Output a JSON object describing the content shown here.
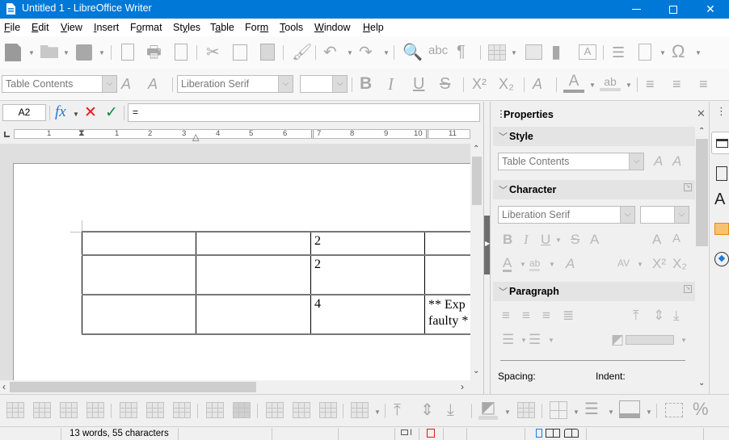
{
  "window": {
    "title": "Untitled 1 - LibreOffice Writer",
    "minimize": "—",
    "maximize": "☐",
    "close": "✕"
  },
  "menu": [
    {
      "label": "File",
      "u": "F",
      "rest": "ile"
    },
    {
      "label": "Edit",
      "u": "E",
      "rest": "dit"
    },
    {
      "label": "View",
      "u": "V",
      "rest": "iew"
    },
    {
      "label": "Insert",
      "u": "I",
      "rest": "nsert"
    },
    {
      "label": "Format",
      "pre": "F",
      "u": "o",
      "rest": "rmat"
    },
    {
      "label": "Styles",
      "pre": "St",
      "u": "y",
      "rest": "les"
    },
    {
      "label": "Table",
      "pre": "T",
      "u": "a",
      "rest": "ble"
    },
    {
      "label": "Form",
      "pre": "For",
      "u": "m",
      "rest": ""
    },
    {
      "label": "Tools",
      "u": "T",
      "rest": "ools"
    },
    {
      "label": "Window",
      "u": "W",
      "rest": "indow"
    },
    {
      "label": "Help",
      "u": "H",
      "rest": "elp"
    }
  ],
  "formatting": {
    "paragraph_style": "Table Contents",
    "font_name": "Liberation Serif",
    "font_size": ""
  },
  "formula_bar": {
    "cell_ref": "A2",
    "fx": "fx",
    "cancel": "✕",
    "accept": "✓",
    "formula": "="
  },
  "ruler": {
    "labels": [
      "1",
      "1",
      "1",
      "2",
      "3",
      "4",
      "5",
      "6",
      "7",
      "8",
      "9",
      "10",
      "11"
    ]
  },
  "document": {
    "table": [
      [
        "",
        "",
        "2",
        ""
      ],
      [
        "",
        "",
        "2",
        ""
      ],
      [
        "",
        "",
        "4",
        "** Exp"
      ]
    ],
    "row3_col4_line2": "faulty *"
  },
  "sidebar": {
    "title": "Properties",
    "close": "✕",
    "sections": {
      "style": {
        "title": "Style",
        "value": "Table Contents"
      },
      "character": {
        "title": "Character",
        "font_name": "Liberation Serif",
        "font_size": ""
      },
      "paragraph": {
        "title": "Paragraph",
        "spacing_label": "Spacing:",
        "indent_label": "Indent:"
      }
    }
  },
  "status_bar": {
    "word_count": "13 words, 55 characters"
  },
  "colors": {
    "titlebar": "#0078d7",
    "cancel_red": "#e81123",
    "accept_green": "#10893e",
    "fx_blue": "#1e7bd1"
  }
}
